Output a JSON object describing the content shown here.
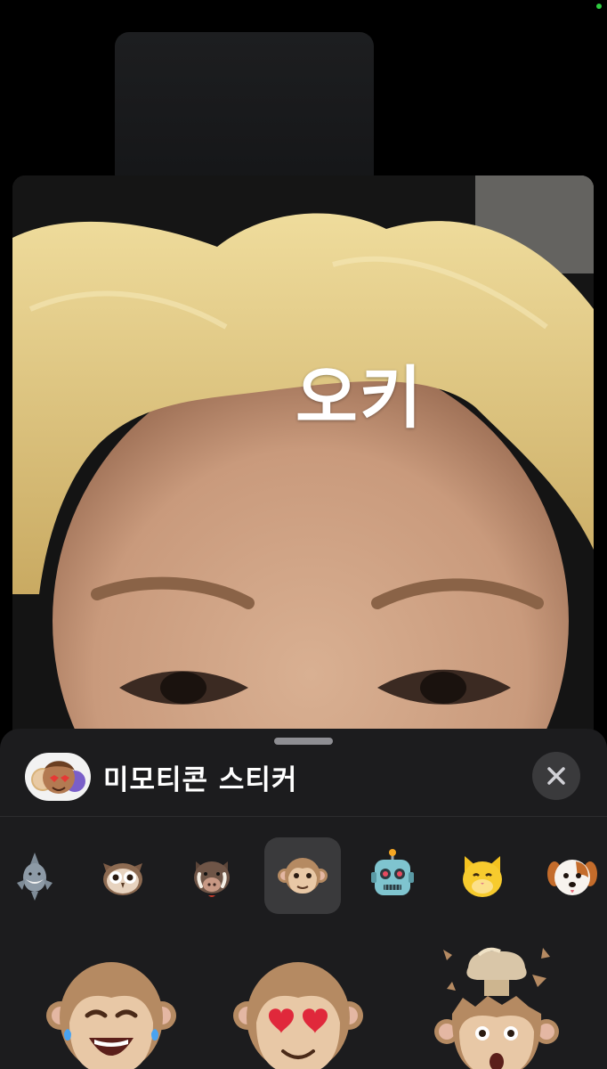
{
  "caption": {
    "text": "오키"
  },
  "sheet": {
    "title": "미모티콘 스티커",
    "app_icon": "memoji-stickers-icon",
    "close_icon": "close-icon"
  },
  "tray": {
    "items": [
      {
        "name": "shark",
        "icon": "shark-icon",
        "selected": false
      },
      {
        "name": "owl",
        "icon": "owl-icon",
        "selected": false
      },
      {
        "name": "boar",
        "icon": "boar-icon",
        "selected": false
      },
      {
        "name": "monkey",
        "icon": "monkey-icon",
        "selected": true
      },
      {
        "name": "robot",
        "icon": "robot-icon",
        "selected": false
      },
      {
        "name": "cat",
        "icon": "cat-icon",
        "selected": false
      },
      {
        "name": "dog",
        "icon": "dog-icon",
        "selected": false
      }
    ]
  },
  "stickers": [
    {
      "name": "monkey-laughing-tears",
      "icon": "monkey-laughing-tears-icon"
    },
    {
      "name": "monkey-heart-eyes",
      "icon": "monkey-heart-eyes-icon"
    },
    {
      "name": "monkey-mind-blown",
      "icon": "monkey-mind-blown-icon"
    }
  ],
  "colors": {
    "sheet_background": "#1c1c1e",
    "selected_tile": "#3a3a3c",
    "status_dot": "#2ecc40"
  }
}
